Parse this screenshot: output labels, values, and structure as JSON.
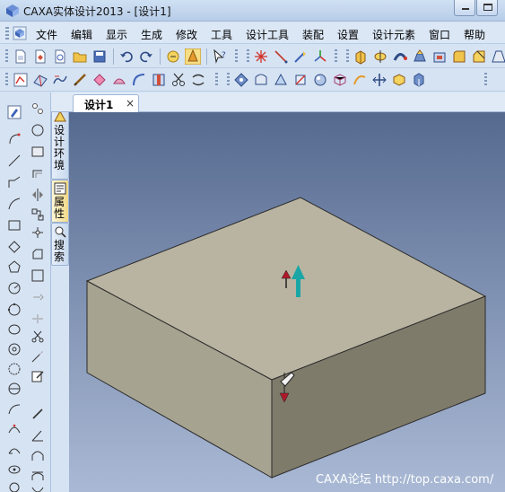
{
  "window": {
    "title": "CAXA实体设计2013 - [设计1]"
  },
  "menu": {
    "items": [
      "文件",
      "编辑",
      "显示",
      "生成",
      "修改",
      "工具",
      "设计工具",
      "装配",
      "设置",
      "设计元素",
      "窗口",
      "帮助"
    ]
  },
  "side_tabs": {
    "design_env": "设计环境",
    "properties": "属性",
    "search": "搜索"
  },
  "document": {
    "tab_label": "设计1",
    "close_glyph": "×"
  },
  "viewport": {
    "watermark": "CAXA论坛 http://top.caxa.com/"
  },
  "colors": {
    "viewport_top": "#55698f",
    "viewport_bottom": "#a9b9d5",
    "block_top": "#b9b4a1",
    "block_left": "#a7a391",
    "block_right": "#7f7b6b",
    "arrow_red": "#b0182a",
    "arrow_teal": "#1aa6a6"
  },
  "icons": {
    "title": "caxa-logo-icon",
    "menu": "caxa-menu-icon"
  }
}
